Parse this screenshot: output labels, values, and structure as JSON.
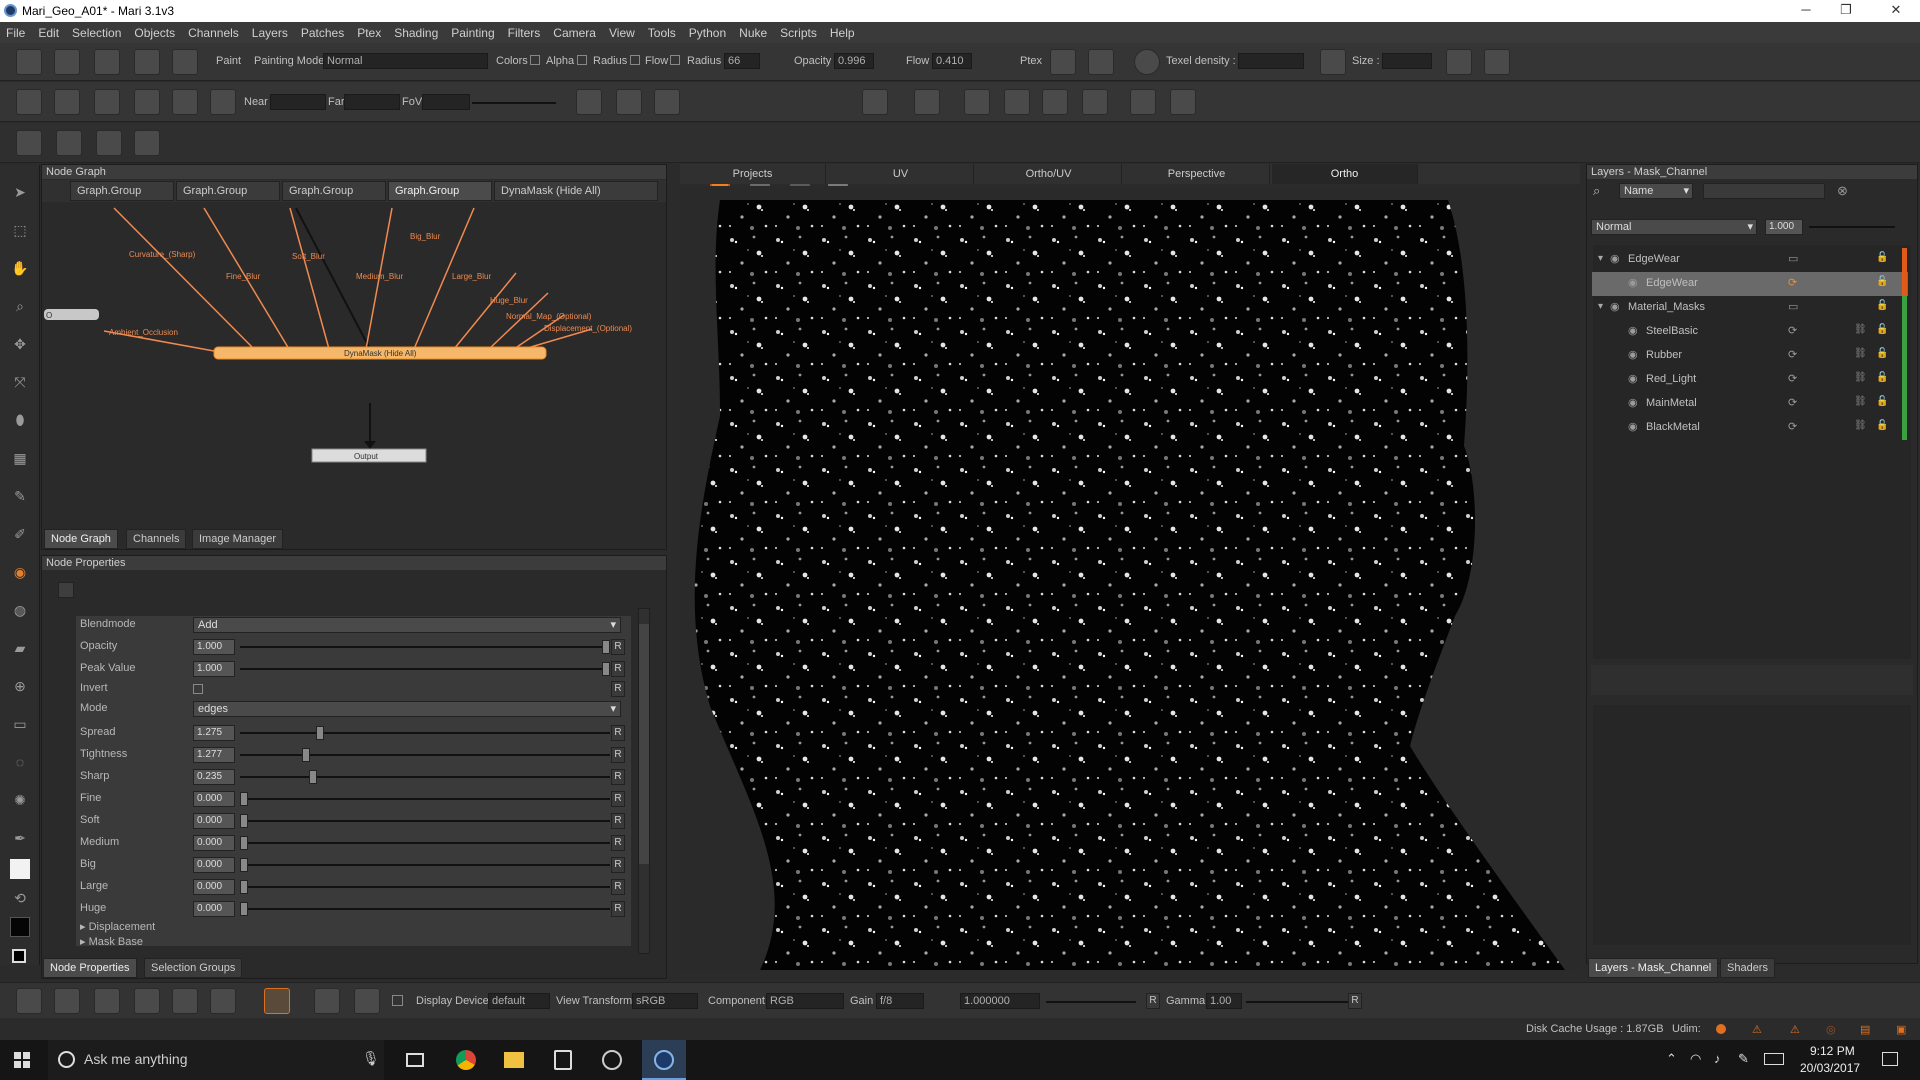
{
  "window": {
    "title": "Mari_Geo_A01* - Mari 3.1v3",
    "minimize": "─",
    "maximize": "❐",
    "close": "✕"
  },
  "menu": [
    "File",
    "Edit",
    "Selection",
    "Objects",
    "Channels",
    "Layers",
    "Patches",
    "Ptex",
    "Shading",
    "Painting",
    "Filters",
    "Camera",
    "View",
    "Tools",
    "Python",
    "Nuke",
    "Scripts",
    "Help"
  ],
  "toolbar1": {
    "paint_label": "Paint",
    "painting_mode_label": "Painting Mode",
    "painting_mode_value": "Normal",
    "colors_label": "Colors",
    "alpha_label": "Alpha",
    "radius_label": "Radius",
    "flow_label": "Flow",
    "radius2_label": "Radius",
    "radius_value": "66",
    "opacity_label": "Opacity",
    "opacity_value": "0.996",
    "flow2_label": "Flow",
    "flow_value": "0.410",
    "ptex_label": "Ptex",
    "texel_label": "Texel density :",
    "size_label": "Size :"
  },
  "toolbar2": {
    "near_label": "Near",
    "far_label": "Far",
    "fov_label": "FoV"
  },
  "node_graph": {
    "title": "Node Graph",
    "tabs": [
      "Graph.Group",
      "Graph.Group",
      "Graph.Group",
      "Graph.Group",
      "DynaMask (Hide All)"
    ],
    "inputs": [
      "Ambient_Occlusion",
      "Curvature_(Sharp)",
      "Fine_Blur",
      "Soft_Blur",
      "Medium_Blur",
      "Big_Blur",
      "Large_Blur",
      "Huge_Blur",
      "Normal_Map_(Optional)",
      "Displacement_(Optional)"
    ],
    "main_node": "DynaMask (Hide All)",
    "output_node": "Output",
    "bottom_tabs": [
      "Node Graph",
      "Channels",
      "Image Manager"
    ]
  },
  "node_properties": {
    "title": "Node Properties",
    "blendmode_label": "Blendmode",
    "blendmode_value": "Add",
    "mode_label": "Mode",
    "mode_value": "edges",
    "invert_label": "Invert",
    "rows": [
      {
        "label": "Opacity",
        "value": "1.000",
        "pos": 1.0
      },
      {
        "label": "Peak Value",
        "value": "1.000",
        "pos": 1.0
      },
      {
        "label": "Spread",
        "value": "1.275",
        "pos": 0.21
      },
      {
        "label": "Tightness",
        "value": "1.277",
        "pos": 0.17
      },
      {
        "label": "Sharp",
        "value": "0.235",
        "pos": 0.19
      },
      {
        "label": "Fine",
        "value": "0.000",
        "pos": 0
      },
      {
        "label": "Soft",
        "value": "0.000",
        "pos": 0
      },
      {
        "label": "Medium",
        "value": "0.000",
        "pos": 0
      },
      {
        "label": "Big",
        "value": "0.000",
        "pos": 0
      },
      {
        "label": "Large",
        "value": "0.000",
        "pos": 0
      },
      {
        "label": "Huge",
        "value": "0.000",
        "pos": 0
      }
    ],
    "reset": "R",
    "sections": [
      "Displacement",
      "Mask Base"
    ],
    "bottom_tabs": [
      "Node Properties",
      "Selection Groups"
    ]
  },
  "viewport": {
    "tabs": [
      "Projects",
      "UV",
      "Ortho/UV",
      "Perspective",
      "Ortho"
    ],
    "active": "Ortho"
  },
  "layers": {
    "title": "Layers - Mask_Channel",
    "filter_mode": "Name",
    "blend": "Normal",
    "opacity": "1.000",
    "items": [
      {
        "name": "EdgeWear",
        "indent": 0,
        "group": true
      },
      {
        "name": "EdgeWear",
        "indent": 1,
        "selected": true
      },
      {
        "name": "Material_Masks",
        "indent": 0,
        "group": true
      },
      {
        "name": "SteelBasic",
        "indent": 1
      },
      {
        "name": "Rubber",
        "indent": 1
      },
      {
        "name": "Red_Light",
        "indent": 1
      },
      {
        "name": "MainMetal",
        "indent": 1
      },
      {
        "name": "BlackMetal",
        "indent": 1
      }
    ],
    "bottom_tabs": [
      "Layers - Mask_Channel",
      "Shaders"
    ]
  },
  "status_toolbar": {
    "display_device_label": "Display Device",
    "display_device_value": "default",
    "view_transform_label": "View Transform",
    "view_transform_value": "sRGB",
    "component_label": "Component",
    "component_value": "RGB",
    "gain_label": "Gain",
    "gain_fstop": "f/8",
    "gain_value": "1.000000",
    "gamma_label": "Gamma",
    "gamma_value": "1.00",
    "reset": "R"
  },
  "status": {
    "disk_cache": "Disk Cache Usage : 1.87GB",
    "udim": "Udim:"
  },
  "taskbar": {
    "search": "Ask me anything",
    "time": "9:12 PM",
    "date": "20/03/2017"
  },
  "colors": {
    "accent_orange": "#f5a623",
    "node_wire": "#f08a50",
    "selected_layer": "#6a6a6a"
  }
}
